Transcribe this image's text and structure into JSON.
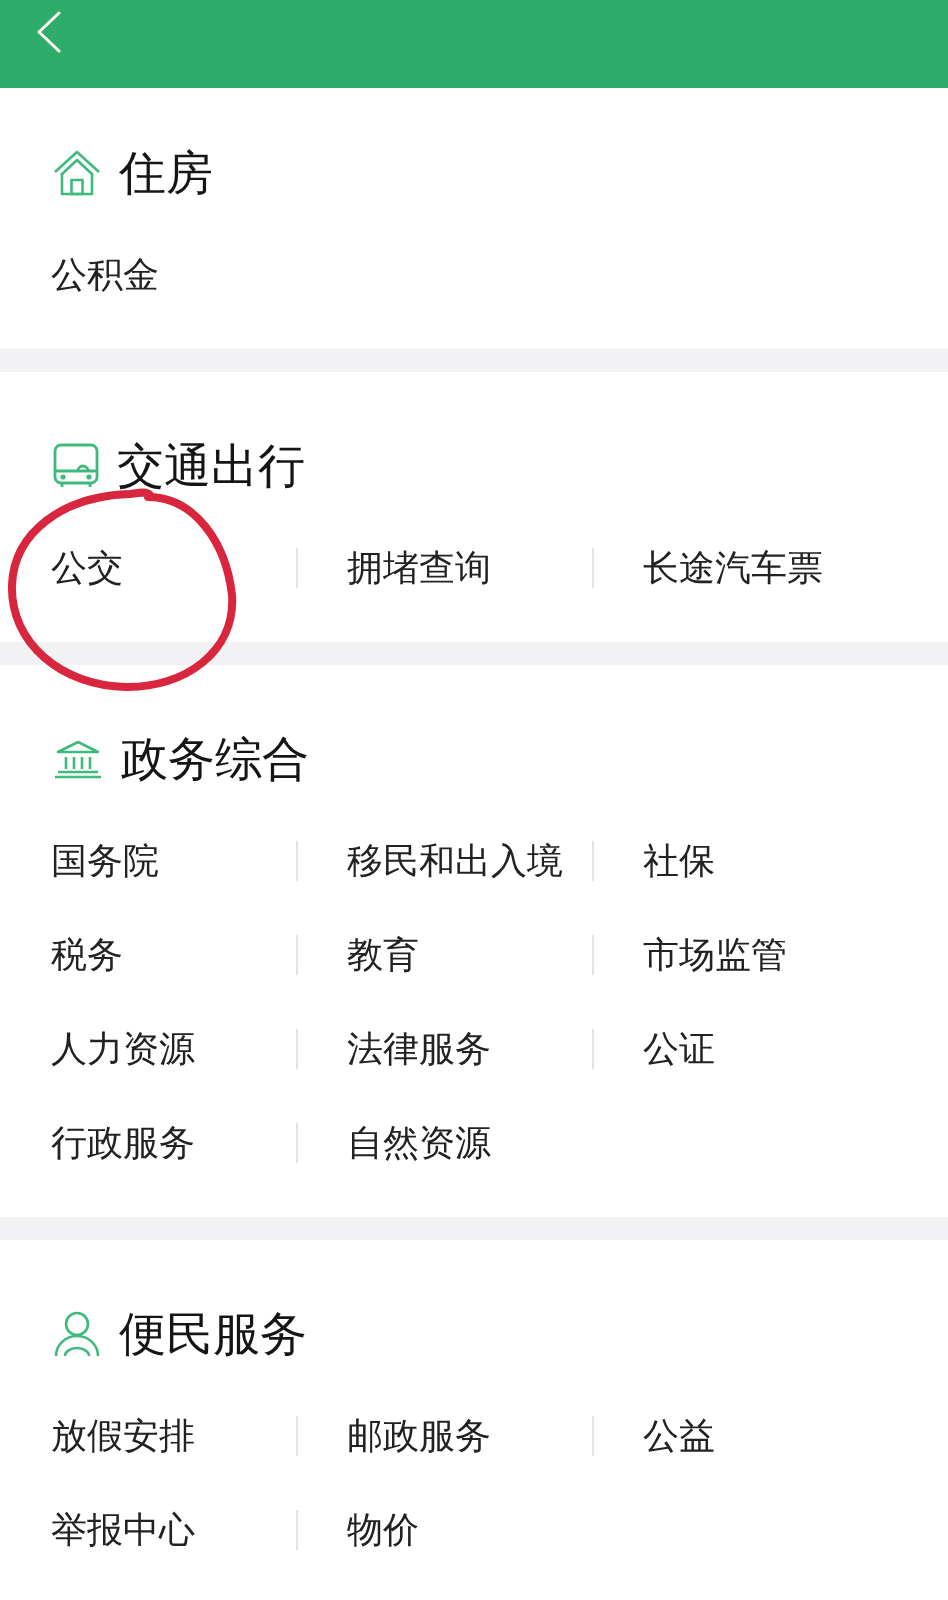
{
  "sections": [
    {
      "kind": "housing",
      "title": "住房",
      "items": [
        {
          "label": "公积金",
          "circled": false
        }
      ]
    },
    {
      "kind": "transport",
      "title": "交通出行",
      "items": [
        {
          "label": "公交",
          "circled": true
        },
        {
          "label": "拥堵查询",
          "circled": false
        },
        {
          "label": "长途汽车票",
          "circled": false
        }
      ]
    },
    {
      "kind": "government",
      "title": "政务综合",
      "items": [
        {
          "label": "国务院",
          "circled": false
        },
        {
          "label": "移民和出入境",
          "circled": false
        },
        {
          "label": "社保",
          "circled": false
        },
        {
          "label": "税务",
          "circled": false
        },
        {
          "label": "教育",
          "circled": false
        },
        {
          "label": "市场监管",
          "circled": false
        },
        {
          "label": "人力资源",
          "circled": false
        },
        {
          "label": "法律服务",
          "circled": false
        },
        {
          "label": "公证",
          "circled": false
        },
        {
          "label": "行政服务",
          "circled": false
        },
        {
          "label": "自然资源",
          "circled": false
        }
      ]
    },
    {
      "kind": "civic",
      "title": "便民服务",
      "items": [
        {
          "label": "放假安排",
          "circled": false
        },
        {
          "label": "邮政服务",
          "circled": false
        },
        {
          "label": "公益",
          "circled": false
        },
        {
          "label": "举报中心",
          "circled": false
        },
        {
          "label": "物价",
          "circled": false
        }
      ]
    }
  ]
}
